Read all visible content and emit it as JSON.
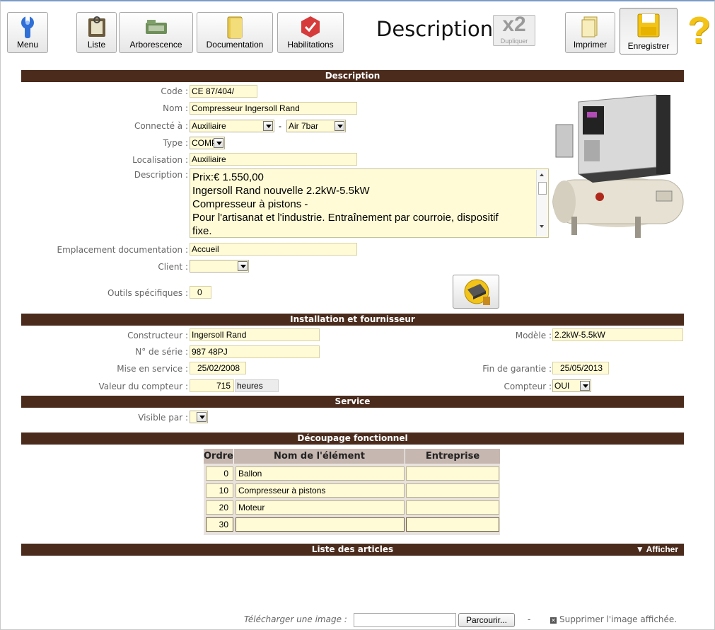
{
  "toolbar": {
    "menu": "Menu",
    "liste": "Liste",
    "arborescence": "Arborescence",
    "documentation": "Documentation",
    "habilitations": "Habilitations",
    "title": "Description",
    "duplicate_big": "x2",
    "duplicate_small": "Dupliquer",
    "imprimer": "Imprimer",
    "enregistrer": "Enregistrer",
    "help": "?"
  },
  "sections": {
    "description": "Description",
    "installation": "Installation et fournisseur",
    "service": "Service",
    "decoupage": "Découpage fonctionnel",
    "articles": "Liste des articles",
    "articles_toggle": "▼ Afficher"
  },
  "form": {
    "code_label": "Code :",
    "code": "CE 87/404/",
    "nom_label": "Nom :",
    "nom": "Compresseur Ingersoll Rand",
    "connecte_label": "Connecté à :",
    "connecte_1": "Auxiliaire",
    "connecte_sep": "-",
    "connecte_2": "Air 7bar",
    "type_label": "Type :",
    "type": "COMP",
    "localisation_label": "Localisation :",
    "localisation": "Auxiliaire",
    "description_label": "Description :",
    "description_lines": [
      "Prix:€ 1.550,00",
      "Ingersoll Rand nouvelle 2.2kW-5.5kW",
      "Compresseur à pistons -",
      "Pour l'artisanat et l'industrie. Entraînement par courroie, dispositif",
      "fixe."
    ],
    "emplacement_label": "Emplacement documentation :",
    "emplacement": "Accueil",
    "client_label": "Client :",
    "client": "",
    "outils_label": "Outils spécifiques :",
    "outils": "0"
  },
  "installation": {
    "constructeur_label": "Constructeur :",
    "constructeur": "Ingersoll Rand",
    "serie_label": "N° de série :",
    "serie": "987 48PJ",
    "mise_label": "Mise en service :",
    "mise": "25/02/2008",
    "compteur_val_label": "Valeur du compteur :",
    "compteur_val": "715",
    "compteur_unit": "heures",
    "modele_label": "Modèle :",
    "modele": "2.2kW-5.5kW",
    "garantie_label": "Fin de garantie :",
    "garantie": "25/05/2013",
    "compteur_label": "Compteur :",
    "compteur": "OUI"
  },
  "service": {
    "visible_label": "Visible par :"
  },
  "decoupage": {
    "headers": [
      "Ordre",
      "Nom de l'élément",
      "Entreprise"
    ],
    "rows": [
      {
        "ordre": "0",
        "nom": "Ballon",
        "entreprise": ""
      },
      {
        "ordre": "10",
        "nom": "Compresseur à pistons",
        "entreprise": ""
      },
      {
        "ordre": "20",
        "nom": "Moteur",
        "entreprise": ""
      },
      {
        "ordre": "30",
        "nom": "",
        "entreprise": ""
      }
    ]
  },
  "upload": {
    "label": "Télécharger une image :",
    "browse": "Parcourir...",
    "dash": "-",
    "delete": "Supprimer l'image affichée."
  },
  "colors": {
    "section_bar": "#4a2b1c",
    "field_bg": "#fffbd6",
    "table_header": "#c6b7b0"
  }
}
